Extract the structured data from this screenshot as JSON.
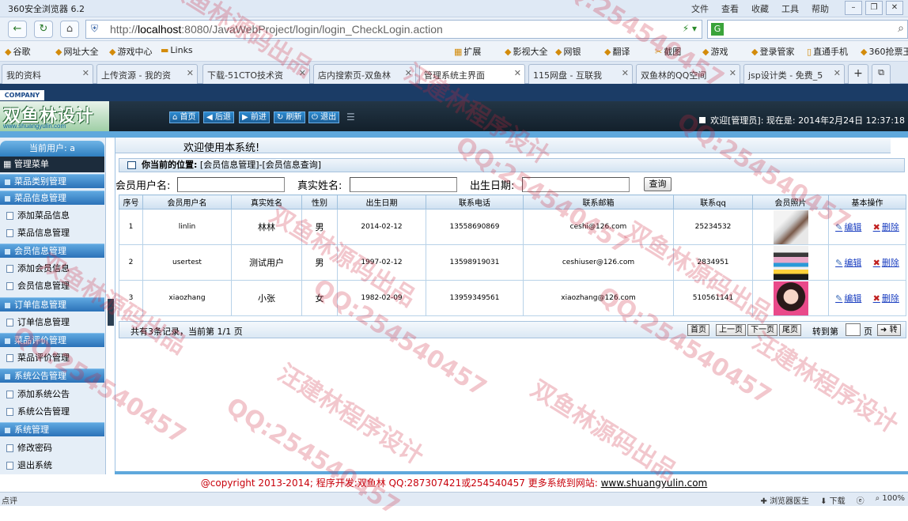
{
  "browser": {
    "title": "360安全浏览器 6.2",
    "menu": [
      "文件",
      "查看",
      "收藏",
      "工具",
      "帮助"
    ],
    "url_host": "localhost",
    "url_rest": ":8080/JavaWebProject/login/login_CheckLogin.action",
    "favorites": [
      "谷歌",
      "网址大全",
      "游戏中心",
      "Links",
      "扩展",
      "影视大全",
      "网银",
      "翻译",
      "截图",
      "游戏",
      "登录管家",
      "直通手机",
      "360抢票王"
    ],
    "tabs": [
      "我的资料",
      "上传资源 - 我的资",
      "下载-51CTO技术资",
      "店内搜索页-双鱼林",
      "管理系统主界面",
      "115网盘 - 互联我",
      "双鱼林的QQ空间",
      "jsp设计类 - 免费_5"
    ],
    "active_tab": 4,
    "status_left": "点评",
    "status_right": [
      "浏览器医生",
      "下载",
      "100%"
    ]
  },
  "header": {
    "company_label": "COMPANY",
    "logo_name": "双鱼林设计",
    "logo_site": "www.shuangyulin.com",
    "buttons": [
      "首页",
      "后退",
      "前进",
      "刷新",
      "退出"
    ],
    "welcome": "欢迎[管理员]: 现在是: 2014年2月24日 12:37:18"
  },
  "sidebar": {
    "current_user": "当前用户: a",
    "menu_title": "管理菜单",
    "sections": [
      {
        "title": "菜品类别管理",
        "items": []
      },
      {
        "title": "菜品信息管理",
        "items": [
          "添加菜品信息",
          "菜品信息管理"
        ]
      },
      {
        "title": "会员信息管理",
        "items": [
          "添加会员信息",
          "会员信息管理"
        ]
      },
      {
        "title": "订单信息管理",
        "items": [
          "订单信息管理"
        ]
      },
      {
        "title": "菜品评价管理",
        "items": [
          "菜品评价管理"
        ]
      },
      {
        "title": "系统公告管理",
        "items": [
          "添加系统公告",
          "系统公告管理"
        ]
      },
      {
        "title": "系统管理",
        "items": [
          "修改密码",
          "退出系统"
        ]
      }
    ]
  },
  "main": {
    "welcome_text": "欢迎使用本系统!",
    "location_label": "你当前的位置:",
    "location_path": "[会员信息管理]-[会员信息查询]",
    "search": {
      "user_label": "会员用户名:",
      "real_label": "真实姓名:",
      "birth_label": "出生日期:",
      "button": "查询"
    },
    "columns": [
      "序号",
      "会员用户名",
      "真实姓名",
      "性别",
      "出生日期",
      "联系电话",
      "联系邮箱",
      "联系qq",
      "会员照片",
      "基本操作"
    ],
    "rows": [
      {
        "no": "1",
        "user": "linlin",
        "real": "林林",
        "sex": "男",
        "birth": "2014-02-12",
        "phone": "13558690869",
        "email": "ceshi@126.com",
        "qq": "25234532"
      },
      {
        "no": "2",
        "user": "usertest",
        "real": "测试用户",
        "sex": "男",
        "birth": "1997-02-12",
        "phone": "13598919031",
        "email": "ceshiuser@126.com",
        "qq": "2834951"
      },
      {
        "no": "3",
        "user": "xiaozhang",
        "real": "小张",
        "sex": "女",
        "birth": "1982-02-09",
        "phone": "13959349561",
        "email": "xiaozhang@126.com",
        "qq": "510561141"
      }
    ],
    "edit_label": "编辑",
    "delete_label": "删除",
    "pager": {
      "info": "共有3条记录，当前第 1/1 页",
      "first": "首页",
      "prev": "上一页",
      "next": "下一页",
      "last": "尾页",
      "jump_label": "转到第",
      "page_unit": "页",
      "go": "转"
    }
  },
  "footer": {
    "text": "@copyright 2013-2014; 程序开发:双鱼林  QQ:287307421或254540457  更多系统到网站:",
    "link": "www.shuangyulin.com"
  },
  "watermarks": [
    "汪建林程序设计",
    "QQ:254540457",
    "双鱼林源码出品"
  ]
}
